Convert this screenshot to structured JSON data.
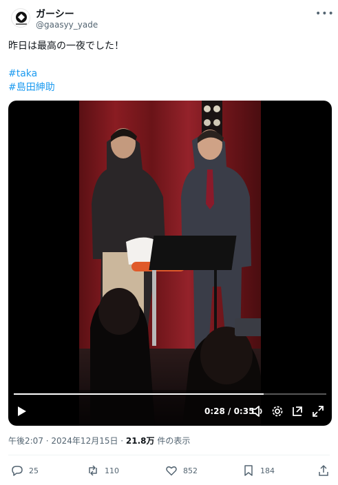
{
  "user": {
    "display_name": "ガーシー",
    "handle": "@gaasyy_yade",
    "avatar_icon": "avatar-logo-icon"
  },
  "tweet": {
    "text": "昨日は最高の一夜でした！",
    "hashtags": [
      "#taka",
      "#島田紳助"
    ]
  },
  "video": {
    "time": "0:28 / 0:35",
    "progress": 0.8,
    "icons": [
      "play-icon",
      "volume-icon",
      "gear-icon",
      "popout-icon",
      "fullscreen-icon"
    ]
  },
  "meta": {
    "timestamp": "午後2:07 · 2024年12月15日 · ",
    "views": "21.8万",
    "views_suffix": " 件の表示"
  },
  "actions": {
    "replies": "25",
    "reposts": "110",
    "likes": "852",
    "bookmarks": "184"
  },
  "colors": {
    "accent": "#1d9bf0",
    "secondary_text": "#536471",
    "primary_text": "#0f1419"
  }
}
